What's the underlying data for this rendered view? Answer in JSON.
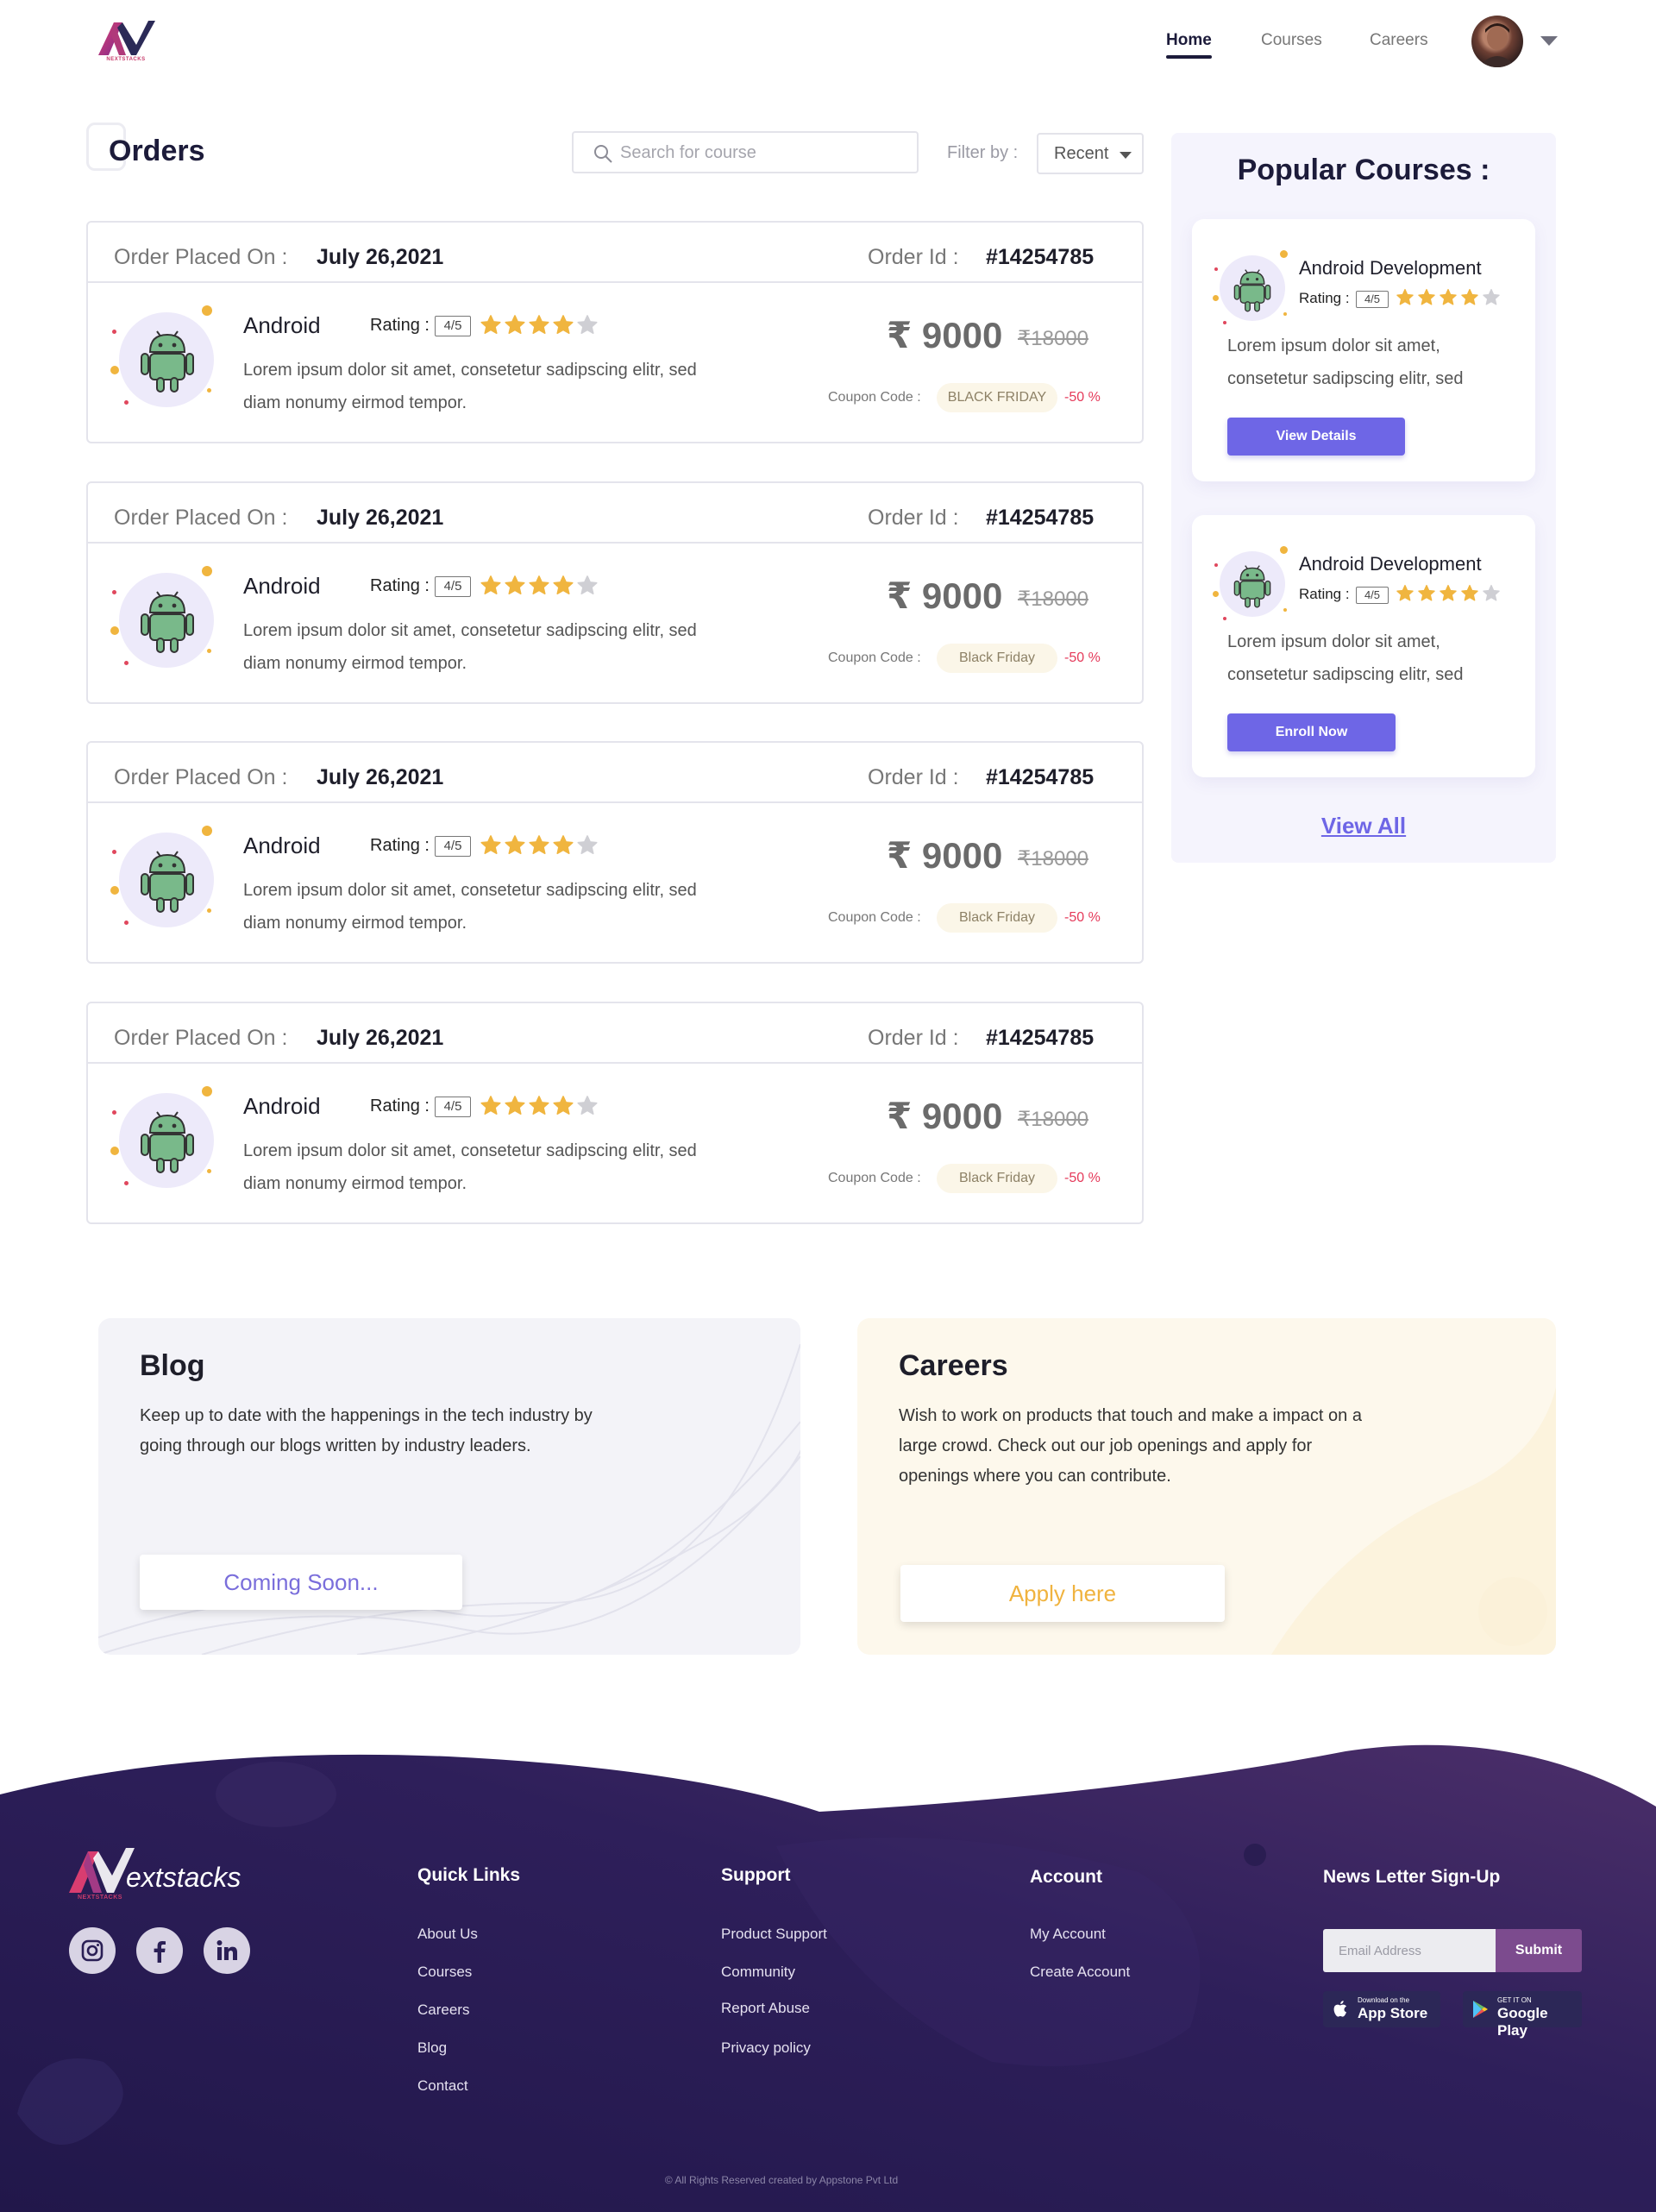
{
  "header": {
    "logo_text": "NEXTSTACKS",
    "nav": [
      "Home",
      "Courses",
      "Careers"
    ],
    "active_nav": "Home"
  },
  "orders": {
    "title": "Orders",
    "search_placeholder": "Search for course",
    "filter_label": "Filter by :",
    "filter_value": "Recent",
    "cards": [
      {
        "placed_label": "Order Placed On :",
        "placed_date": "July 26,2021",
        "id_label": "Order Id :",
        "id": "#14254785",
        "course": "Android",
        "rating_label": "Rating :",
        "rating": "4/5",
        "stars": 4,
        "desc": "Lorem ipsum dolor sit amet, consetetur sadipscing elitr, sed diam nonumy eirmod tempor.",
        "price": "₹ 9000",
        "old_price": "₹18000",
        "coupon_label": "Coupon Code :",
        "coupon": "BLACK FRIDAY",
        "discount": "-50 %"
      },
      {
        "placed_label": "Order Placed On :",
        "placed_date": "July 26,2021",
        "id_label": "Order Id :",
        "id": "#14254785",
        "course": "Android",
        "rating_label": "Rating :",
        "rating": "4/5",
        "stars": 4,
        "desc": "Lorem ipsum dolor sit amet, consetetur sadipscing elitr, sed diam nonumy eirmod tempor.",
        "price": "₹ 9000",
        "old_price": "₹18000",
        "coupon_label": "Coupon Code :",
        "coupon": "Black Friday",
        "discount": "-50 %"
      },
      {
        "placed_label": "Order Placed On :",
        "placed_date": "July 26,2021",
        "id_label": "Order Id :",
        "id": "#14254785",
        "course": "Android",
        "rating_label": "Rating :",
        "rating": "4/5",
        "stars": 4,
        "desc": "Lorem ipsum dolor sit amet, consetetur sadipscing elitr, sed diam nonumy eirmod tempor.",
        "price": "₹ 9000",
        "old_price": "₹18000",
        "coupon_label": "Coupon Code :",
        "coupon": "Black Friday",
        "discount": "-50 %"
      },
      {
        "placed_label": "Order Placed On :",
        "placed_date": "July 26,2021",
        "id_label": "Order Id :",
        "id": "#14254785",
        "course": "Android",
        "rating_label": "Rating :",
        "rating": "4/5",
        "stars": 4,
        "desc": "Lorem ipsum dolor sit amet, consetetur sadipscing elitr, sed diam nonumy eirmod tempor.",
        "price": "₹ 9000",
        "old_price": "₹18000",
        "coupon_label": "Coupon Code :",
        "coupon": "Black Friday",
        "discount": "-50 %"
      }
    ]
  },
  "popular": {
    "title": "Popular Courses :",
    "cards": [
      {
        "name": "Android Development",
        "rating_label": "Rating :",
        "rating": "4/5",
        "stars": 4,
        "desc": "Lorem ipsum dolor sit amet, consetetur sadipscing elitr, sed",
        "button": "View Details"
      },
      {
        "name": "Android Development",
        "rating_label": "Rating :",
        "rating": "4/5",
        "stars": 4,
        "desc": "Lorem ipsum dolor sit amet, consetetur sadipscing elitr, sed",
        "button": "Enroll Now"
      }
    ],
    "view_all": "View All"
  },
  "blog": {
    "title": "Blog",
    "text": "Keep up to date with the happenings in the tech industry by going through our blogs written by industry leaders.",
    "button": "Coming Soon..."
  },
  "careers": {
    "title": "Careers",
    "text": "Wish to work on products that touch and make a impact on a large crowd. Check out our job openings and apply for openings where you can contribute.",
    "button": "Apply here"
  },
  "footer": {
    "brand": "extstacks",
    "brand_sub": "NEXTSTACKS",
    "social": [
      "instagram-icon",
      "facebook-icon",
      "linkedin-icon"
    ],
    "quick_links": {
      "title": "Quick Links",
      "items": [
        "About Us",
        "Courses",
        "Careers",
        "Blog",
        "Contact"
      ]
    },
    "support": {
      "title": "Support",
      "items": [
        "Product Support",
        "Community",
        "Report Abuse",
        "Privacy policy"
      ]
    },
    "account": {
      "title": "Account",
      "items": [
        "My Account",
        "Create Account"
      ]
    },
    "newsletter": {
      "title": "News Letter Sign-Up",
      "placeholder": "Email Address",
      "submit": "Submit",
      "app_store_small": "Download on the",
      "app_store_big": "App Store",
      "google_small": "GET IT ON",
      "google_big": "Google Play"
    },
    "copyright": "© All Rights Reserved created by Appstone Pvt Ltd"
  },
  "colors": {
    "primary": "#6e66e6",
    "dark_navy": "#1c1b3a",
    "star_gold": "#f0b53f",
    "star_grey": "#cfcfd4",
    "discount_red": "#e53a5a",
    "footer_purple": "#2a1c55"
  }
}
